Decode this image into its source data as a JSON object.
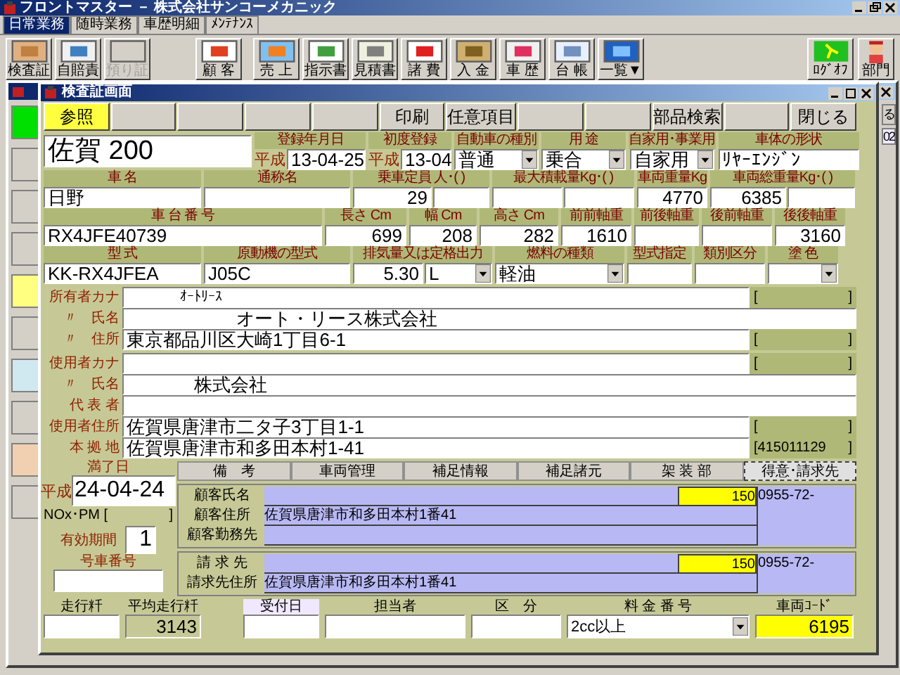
{
  "app_window": {
    "title": "フロントマスター － 株式会社サンコーメカニック"
  },
  "menu_tabs": [
    {
      "label": "日常業務",
      "selected": true
    },
    {
      "label": "随時業務",
      "selected": false
    },
    {
      "label": "車歴明細",
      "selected": false
    },
    {
      "label": "ﾒﾝﾃﾅﾝｽ",
      "selected": false
    }
  ],
  "toolbar": {
    "groups": [
      {
        "items": [
          {
            "label": "検査証",
            "disabled": false
          },
          {
            "label": "自賠責",
            "disabled": false
          },
          {
            "label": "預り証",
            "disabled": true
          }
        ]
      },
      {
        "items": [
          {
            "label": "顧 客",
            "disabled": false
          }
        ]
      },
      {
        "items": [
          {
            "label": "売 上",
            "disabled": false
          },
          {
            "label": "指示書",
            "disabled": false
          },
          {
            "label": "見積書",
            "disabled": false
          },
          {
            "label": "諸 費",
            "disabled": false
          },
          {
            "label": "入 金",
            "disabled": false
          },
          {
            "label": "車 歴",
            "disabled": false
          },
          {
            "label": "台 帳",
            "disabled": false
          },
          {
            "label": "一覧▼",
            "disabled": false
          }
        ]
      }
    ],
    "right": [
      {
        "label": "ﾛｸﾞｵﾌ"
      },
      {
        "label": "部門"
      }
    ]
  },
  "back_window": {
    "button_fragment": "る",
    "field_fragment": "02"
  },
  "dialog": {
    "title": "検査証画面",
    "buttons": [
      {
        "kind": "button",
        "label": "参照",
        "selected": true
      },
      {
        "kind": "blank",
        "selected": false
      },
      {
        "kind": "blank",
        "selected": false
      },
      {
        "kind": "blank",
        "selected": false
      },
      {
        "kind": "blank",
        "selected": false
      },
      {
        "kind": "button",
        "label": "印刷",
        "selected": false
      },
      {
        "kind": "button",
        "label": "任意項目",
        "selected": false
      },
      {
        "kind": "blank",
        "selected": false
      },
      {
        "kind": "blank",
        "selected": false
      },
      {
        "kind": "button",
        "label": "部品検索",
        "selected": false
      },
      {
        "kind": "blank",
        "selected": false
      },
      {
        "kind": "button",
        "label": "閉じる",
        "selected": false
      }
    ],
    "spec_rows": [
      {
        "cells": [
          {
            "kind": "plate",
            "fields": [
              {
                "kind": "text",
                "value": "佐賀 200"
              }
            ]
          },
          {
            "kind": "date",
            "label": "登録年月日",
            "era": "平成",
            "fields": [
              {
                "kind": "text",
                "value": "13-04-25"
              }
            ]
          },
          {
            "kind": "date",
            "label": "初度登録",
            "era": "平成",
            "fields": [
              {
                "kind": "text",
                "value": "13-04"
              }
            ]
          },
          {
            "kind": "field",
            "label": "自動車の種別",
            "fields": [
              {
                "kind": "dropdown",
                "value": "普通"
              }
            ]
          },
          {
            "kind": "field",
            "label": "用 途",
            "fields": [
              {
                "kind": "dropdown",
                "value": "乗合"
              }
            ]
          },
          {
            "kind": "field",
            "label": "自家用･事業用",
            "fields": [
              {
                "kind": "dropdown",
                "value": "自家用"
              }
            ]
          },
          {
            "kind": "field",
            "label": "車体の形状",
            "fields": [
              {
                "kind": "text",
                "value": "ﾘﾔｰｴﾝｼﾞﾝ"
              }
            ]
          }
        ]
      },
      {
        "cells": [
          {
            "kind": "field",
            "label": "車 名",
            "fields": [
              {
                "kind": "text",
                "value": "日野"
              }
            ]
          },
          {
            "kind": "field",
            "label": "通称名",
            "fields": [
              {
                "kind": "text"
              }
            ]
          },
          {
            "kind": "field",
            "label": "乗車定員 人･( )",
            "fields": [
              {
                "kind": "number",
                "value": "29"
              },
              {
                "kind": "text"
              }
            ]
          },
          {
            "kind": "field",
            "label": "最大積載量Kg･( )",
            "fields": [
              {
                "kind": "text"
              },
              {
                "kind": "text"
              }
            ]
          },
          {
            "kind": "field",
            "label": "車両重量Kg",
            "fields": [
              {
                "kind": "number",
                "value": "4770"
              }
            ]
          },
          {
            "kind": "field",
            "label": "車両総重量Kg･( )",
            "fields": [
              {
                "kind": "number",
                "value": "6385"
              },
              {
                "kind": "text"
              }
            ]
          }
        ]
      },
      {
        "cells": [
          {
            "kind": "field",
            "label": "車 台 番 号",
            "fields": [
              {
                "kind": "text",
                "value": "RX4JFE40739"
              }
            ]
          },
          {
            "kind": "field",
            "label": "長さ Cm",
            "fields": [
              {
                "kind": "number",
                "value": "699"
              }
            ]
          },
          {
            "kind": "field",
            "label": "幅 Cm",
            "fields": [
              {
                "kind": "number",
                "value": "208"
              }
            ]
          },
          {
            "kind": "field",
            "label": "高さ Cm",
            "fields": [
              {
                "kind": "number",
                "value": "282"
              }
            ]
          },
          {
            "kind": "field",
            "label": "前前軸重",
            "fields": [
              {
                "kind": "number",
                "value": "1610"
              }
            ]
          },
          {
            "kind": "field",
            "label": "前後軸重",
            "fields": [
              {
                "kind": "text"
              }
            ]
          },
          {
            "kind": "field",
            "label": "後前軸重",
            "fields": [
              {
                "kind": "text"
              }
            ]
          },
          {
            "kind": "field",
            "label": "後後軸重",
            "fields": [
              {
                "kind": "number",
                "value": "3160"
              }
            ]
          }
        ]
      },
      {
        "cells": [
          {
            "kind": "field",
            "label": "型 式",
            "fields": [
              {
                "kind": "text",
                "value": "KK-RX4JFEA"
              }
            ]
          },
          {
            "kind": "field",
            "label": "原動機の型式",
            "fields": [
              {
                "kind": "text",
                "value": "J05C"
              }
            ]
          },
          {
            "kind": "field",
            "label": "排気量又は定格出力",
            "fields": [
              {
                "kind": "number",
                "value": "5.30"
              },
              {
                "kind": "dropdown",
                "value": "L"
              }
            ]
          },
          {
            "kind": "field",
            "label": "燃料の種類",
            "fields": [
              {
                "kind": "dropdown",
                "value": "軽油"
              }
            ]
          },
          {
            "kind": "field",
            "label": "型式指定",
            "fields": [
              {
                "kind": "text"
              }
            ]
          },
          {
            "kind": "field",
            "label": "類別区分",
            "fields": [
              {
                "kind": "text"
              }
            ]
          },
          {
            "kind": "field",
            "label": "塗 色",
            "fields": [
              {
                "kind": "dropdown"
              }
            ]
          }
        ]
      }
    ],
    "owner_rows": [
      {
        "kind": "kana",
        "label": "所有者カナ",
        "value": "ｵｰﾄﾘｰｽ",
        "code": {
          "open": "[",
          "close": "]"
        }
      },
      {
        "kind": "owner_name",
        "label": "〃　氏名",
        "value": "オート・リース株式会社"
      },
      {
        "kind": "address",
        "label": "〃　住所",
        "value": "東京都品川区大崎1丁目6-1",
        "code": {
          "open": "[",
          "close": "]"
        }
      }
    ],
    "user_rows": [
      {
        "kind": "kana",
        "label": "使用者カナ",
        "code": {
          "open": "[",
          "close": "]"
        }
      },
      {
        "kind": "user_name",
        "label": "〃　氏名",
        "value": "株式会社"
      },
      {
        "kind": "representative",
        "label": "代 表 者"
      },
      {
        "kind": "address",
        "label": "使用者住所",
        "value": "佐賀県唐津市二タ子3丁目1-1",
        "code": {
          "open": "[",
          "close": "]"
        }
      },
      {
        "kind": "address",
        "label": "本 拠 地",
        "value": "佐賀県唐津市和多田本村1-41",
        "code": {
          "open": "[",
          "value": "415011129",
          "close": "]"
        }
      }
    ],
    "expiry": {
      "label": "満了日",
      "era": "平成",
      "value": "24-04-24",
      "nox_label": "NOx･PM",
      "nox_open": "[",
      "nox_close": "]",
      "period_label": "有効期間",
      "period_value": "1",
      "car_number_label": "号車番号"
    },
    "tabs": [
      {
        "label": "備　考",
        "selected": false
      },
      {
        "label": "車両管理",
        "selected": false
      },
      {
        "label": "補足情報",
        "selected": false
      },
      {
        "label": "補足諸元",
        "selected": false
      },
      {
        "label": "架 装 部",
        "selected": false
      },
      {
        "label": "得意･請求先",
        "selected": true
      }
    ],
    "customer_groups": [
      {
        "rows": [
          {
            "label": "顧客氏名",
            "number": "150",
            "phone": "0955-72-"
          },
          {
            "label": "顧客住所",
            "value": "佐賀県唐津市和多田本村1番41"
          },
          {
            "label": "顧客勤務先"
          }
        ]
      },
      {
        "rows": [
          {
            "label": "請 求 先",
            "number": "150",
            "phone": "0955-72-"
          },
          {
            "label": "請求先住所",
            "value": "佐賀県唐津市和多田本村1番41"
          }
        ]
      }
    ],
    "bottom_fields": [
      {
        "kind": "text",
        "label": "走行粁"
      },
      {
        "kind": "readonly",
        "label": "平均走行粁",
        "value": "3143"
      },
      {
        "kind": "text",
        "label": "受付日"
      },
      {
        "kind": "text",
        "label": "担当者"
      },
      {
        "kind": "text",
        "label": "区　分"
      },
      {
        "kind": "dropdown",
        "label": "料 金 番 号",
        "value": "2cc以上"
      },
      {
        "kind": "highlight",
        "label": "車両ｺｰﾄﾞ",
        "value": "6195"
      }
    ]
  }
}
